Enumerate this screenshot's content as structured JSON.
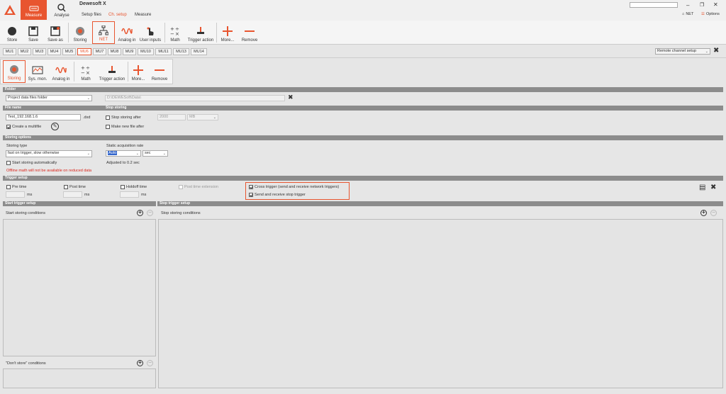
{
  "app": {
    "title": "Dewesoft X",
    "search_value": "",
    "net_label": "NET",
    "options_label": "Options"
  },
  "main_tabs": {
    "measure": "Measure",
    "analyse": "Analyse"
  },
  "sub_tabs": [
    "Setup files",
    "Ch. setup",
    "Measure"
  ],
  "toolbar": [
    {
      "label": "Store",
      "icon": "record-icon"
    },
    {
      "label": "Save",
      "icon": "floppy-icon"
    },
    {
      "label": "Save as",
      "icon": "floppy-as-icon"
    },
    {
      "label": "Storing",
      "icon": "storing-icon"
    },
    {
      "label": "NET",
      "icon": "network-icon"
    },
    {
      "label": "Analog in",
      "icon": "analog-wave-icon"
    },
    {
      "label": "User inputs",
      "icon": "hand-pointer-icon"
    },
    {
      "label": "Math",
      "icon": "math-icon"
    },
    {
      "label": "Trigger action",
      "icon": "trigger-icon"
    },
    {
      "label": "More...",
      "icon": "plus-icon"
    },
    {
      "label": "Remove",
      "icon": "minus-icon"
    }
  ],
  "mu_tabs": [
    "MU1",
    "MU2",
    "MU3",
    "MU4",
    "MU5",
    "MU6",
    "MU7",
    "MU8",
    "MU9",
    "MU10",
    "MU11",
    "MU13",
    "MU14"
  ],
  "remote_channel_setup": "Remote channel setup",
  "toolbar2": [
    {
      "label": "Storing",
      "icon": "storing-icon"
    },
    {
      "label": "Sys. mon.",
      "icon": "system-monitor-icon"
    },
    {
      "label": "Analog in",
      "icon": "analog-wave-icon"
    },
    {
      "label": "Math",
      "icon": "math-icon"
    },
    {
      "label": "Trigger action",
      "icon": "trigger-icon"
    },
    {
      "label": "More...",
      "icon": "plus-icon"
    },
    {
      "label": "Remove",
      "icon": "minus-icon"
    }
  ],
  "folder": {
    "header": "Folder",
    "selection": "Project data files folder",
    "path": "D:\\DEWESoft\\Data\\"
  },
  "file_name": {
    "header": "File name",
    "value": "Test_192.168.1.6",
    "ext": ".dxd",
    "create_multifile": "Create a multifile"
  },
  "stop_storing": {
    "header": "Stop storing",
    "stop_after": "Stop storing after",
    "stop_after_value": "2000",
    "unit": "MB",
    "make_new_file": "Make new file after"
  },
  "storing_options": {
    "header": "Storing options",
    "type_label": "Storing type",
    "type_value": "fast on trigger, slow otherwise",
    "static_rate_label": "Static acquisition rate",
    "static_rate_value": "Auto",
    "static_rate_unit": "sec",
    "adjusted_text": "Adjusted to 0.2 sec",
    "start_auto": "Start storing automatically",
    "warning": "Offline math will not be available  on reduced  data"
  },
  "trigger_setup": {
    "header": "Trigger setup",
    "pre_time": "Pre time",
    "post_time": "Post time",
    "holdoff_time": "Holdoff time",
    "post_time_ext": "Post time extension",
    "ms": "ms",
    "cross_trigger": "Cross trigger (send and receive network triggers)",
    "send_receive_stop": "Send and receive stop trigger"
  },
  "start_trigger": {
    "header": "Start trigger setup",
    "conditions": "Start storing conditions",
    "dont_store": "\"Don't store\" conditions"
  },
  "stop_trigger": {
    "header": "Stop trigger setup",
    "conditions": "Stop storing conditions"
  },
  "colors": {
    "accent": "#e8552f",
    "header_gray": "#8c8c8c"
  }
}
